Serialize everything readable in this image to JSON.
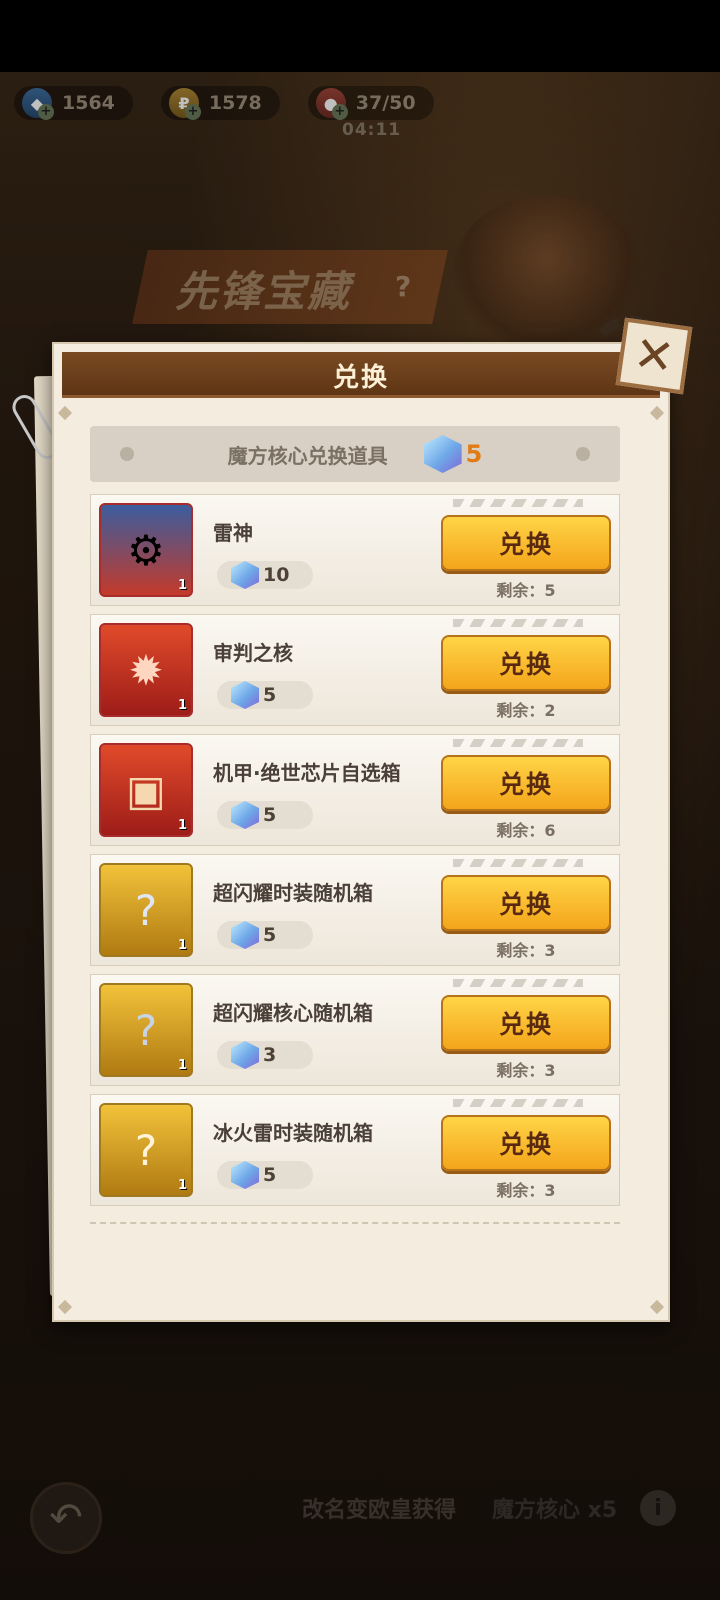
{
  "resources": [
    {
      "icon": "gem-icon",
      "value": "1564"
    },
    {
      "icon": "gold-icon",
      "value": "1578"
    },
    {
      "icon": "stamina-icon",
      "value": "37/50"
    }
  ],
  "timer": "04:11",
  "event": {
    "title": "先锋宝藏",
    "help": "?"
  },
  "dialog": {
    "title": "兑换",
    "close": "✕",
    "currency_label": "魔方核心兑换道具",
    "currency_count": "5",
    "items": [
      {
        "name": "雷神",
        "price": "10",
        "qty": "1",
        "icon": "mech-thor-icon",
        "button": "兑换",
        "remain": "剩余：5"
      },
      {
        "name": "审判之核",
        "price": "5",
        "qty": "1",
        "icon": "judgment-core-icon",
        "button": "兑换",
        "remain": "剩余：2"
      },
      {
        "name": "机甲·绝世芯片自选箱",
        "price": "5",
        "qty": "1",
        "icon": "chip-box-icon",
        "button": "兑换",
        "remain": "剩余：6"
      },
      {
        "name": "超闪耀时装随机箱",
        "price": "5",
        "qty": "1",
        "icon": "costume-box-icon",
        "button": "兑换",
        "remain": "剩余：3"
      },
      {
        "name": "超闪耀核心随机箱",
        "price": "3",
        "qty": "1",
        "icon": "core-box-icon",
        "button": "兑换",
        "remain": "剩余：3"
      },
      {
        "name": "冰火雷时装随机箱",
        "price": "5",
        "qty": "1",
        "icon": "elemental-costume-box-icon",
        "button": "兑换",
        "remain": "剩余：3"
      }
    ]
  },
  "bottom": {
    "promo_text": "改名变欧皇获得",
    "promo_item": "魔方核心 x5",
    "info": "i"
  }
}
